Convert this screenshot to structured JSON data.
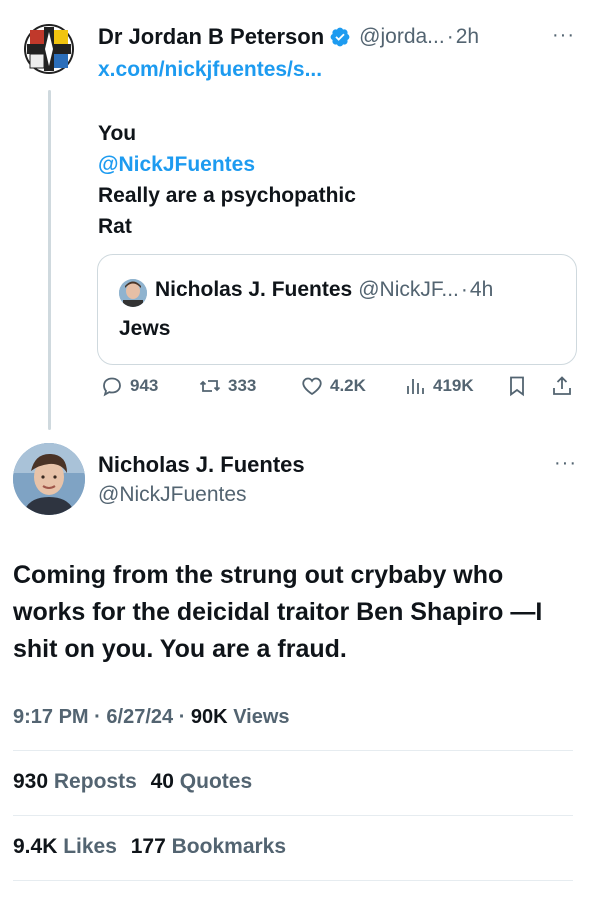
{
  "parent_tweet": {
    "author_name": "Dr Jordan B Peterson",
    "handle": "@jorda...",
    "separator": "·",
    "time": "2h",
    "link": "x.com/nickjfuentes/s...",
    "line1": "You",
    "mention": "@NickJFuentes",
    "line3": "Really are a psychopathic",
    "line4": "Rat",
    "quoted": {
      "author_name": "Nicholas J. Fuentes",
      "handle": "@NickJF...",
      "separator": "·",
      "time": "4h",
      "text": "Jews"
    },
    "actions": {
      "replies": "943",
      "reposts": "333",
      "likes": "4.2K",
      "views": "419K"
    }
  },
  "reply_tweet": {
    "author_name": "Nicholas J. Fuentes",
    "handle": "@NickJFuentes",
    "text": "Coming from the strung out crybaby who works for the deicidal traitor Ben Shapiro —I shit on you. You are a fraud.",
    "time": "9:17 PM",
    "date": "6/27/24",
    "separator": "·",
    "views_count": "90K",
    "views_label": "Views",
    "reposts_count": "930",
    "reposts_label": "Reposts",
    "quotes_count": "40",
    "quotes_label": "Quotes",
    "likes_count": "9.4K",
    "likes_label": "Likes",
    "bookmarks_count": "177",
    "bookmarks_label": "Bookmarks"
  },
  "colors": {
    "accent": "#1d9bf0",
    "text": "#0f1419",
    "muted": "#536471",
    "border": "#cfd9de"
  }
}
